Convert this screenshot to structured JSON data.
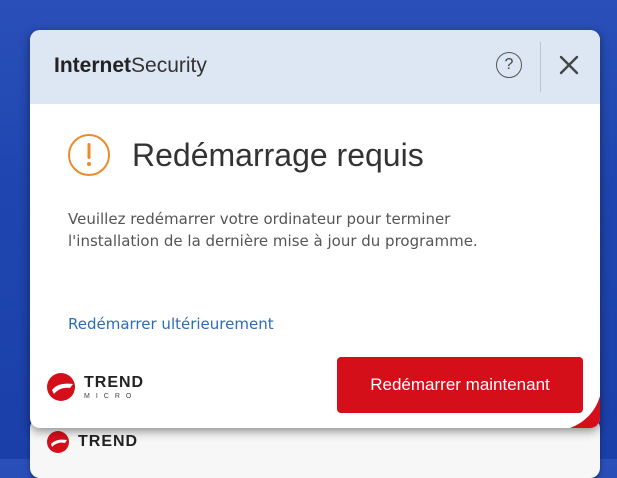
{
  "app": {
    "title_bold": "Internet",
    "title_rest": "Security"
  },
  "titlebar": {
    "help_label": "?"
  },
  "dialog": {
    "heading": "Redémarrage requis",
    "message_line1": "Veuillez redémarrer votre ordinateur pour terminer",
    "message_line2": "l'installation de la dernière mise à jour du programme.",
    "later_link": "Redémarrer ultérieurement",
    "restart_button": "Redémarrer maintenant"
  },
  "brand": {
    "line1": "TREND",
    "line2": "MICRO"
  },
  "back_brand": {
    "line1": "TREND"
  },
  "colors": {
    "accent": "#d50f1a",
    "warning": "#ee8a2a",
    "link": "#2a6db8",
    "titlebar": "#dde6f3"
  },
  "icons": {
    "warning": "exclamation-circle-icon",
    "help": "question-circle-icon",
    "close": "close-icon",
    "logo": "trend-micro-logo"
  }
}
